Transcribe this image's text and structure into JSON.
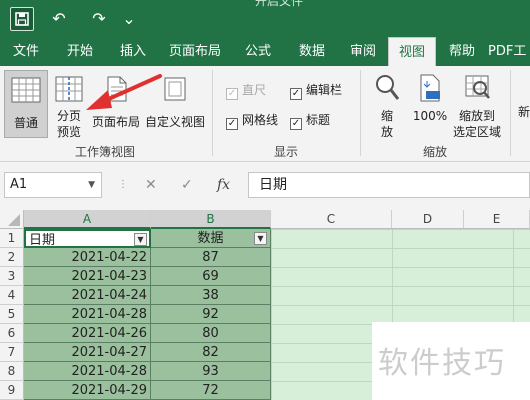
{
  "window": {
    "title_partial": "开启文件"
  },
  "quick_access": {
    "save": "save-icon",
    "undo": "↶",
    "redo": "↷",
    "more": "⌄"
  },
  "tabs": [
    "文件",
    "开始",
    "插入",
    "页面布局",
    "公式",
    "数据",
    "审阅",
    "视图",
    "帮助",
    "PDF工"
  ],
  "active_tab": "视图",
  "ribbon": {
    "workbook_views": {
      "group_label": "工作簿视图",
      "normal": "普通",
      "page_break_1": "分页",
      "page_break_2": "预览",
      "page_layout": "页面布局",
      "custom_views": "自定义视图"
    },
    "show": {
      "group_label": "显示",
      "ruler": "直尺",
      "gridlines": "网格线",
      "formula_bar": "编辑栏",
      "headings": "标题"
    },
    "zoom": {
      "group_label": "缩放",
      "zoom_1": "缩",
      "zoom_2": "放",
      "zoom_100": "100%",
      "to_selection_1": "缩放到",
      "to_selection_2": "选定区域"
    },
    "new_window_partial": "新"
  },
  "formula_bar": {
    "name_box": "A1",
    "cancel": "✕",
    "enter": "✓",
    "fx": "fx",
    "content": "日期"
  },
  "columns": [
    "A",
    "B",
    "C",
    "D",
    "E"
  ],
  "rows": [
    "1",
    "2",
    "3",
    "4",
    "5",
    "6",
    "7",
    "8",
    "9"
  ],
  "table": {
    "headers": [
      "日期",
      "数据"
    ],
    "data": [
      [
        "2021-04-22",
        "87"
      ],
      [
        "2021-04-23",
        "69"
      ],
      [
        "2021-04-24",
        "38"
      ],
      [
        "2021-04-28",
        "92"
      ],
      [
        "2021-04-26",
        "80"
      ],
      [
        "2021-04-27",
        "82"
      ],
      [
        "2021-04-28",
        "93"
      ],
      [
        "2021-04-29",
        "72"
      ]
    ]
  },
  "watermark": "软件技巧",
  "colors": {
    "accent": "#217346",
    "page_break_bg": "#d7eed9",
    "data_area": "#9bc09e"
  }
}
